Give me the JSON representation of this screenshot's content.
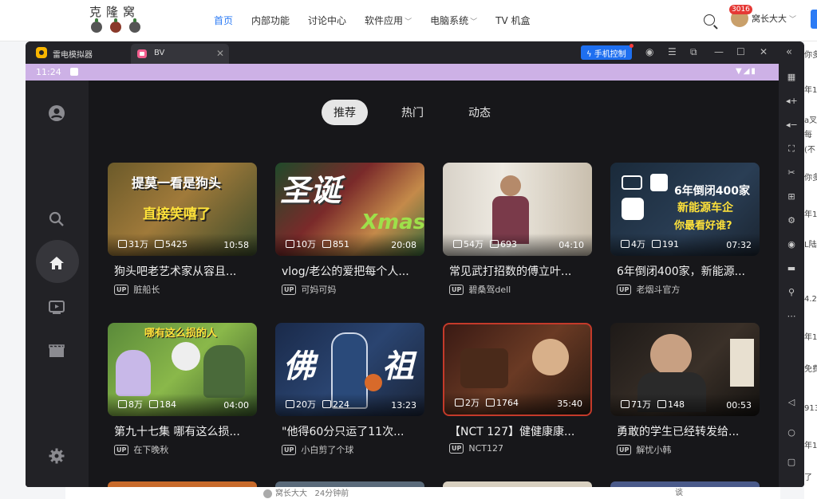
{
  "site": {
    "logo_text": "克隆窝",
    "nav": [
      {
        "label": "首页",
        "active": true,
        "dropdown": false
      },
      {
        "label": "内部功能",
        "active": false,
        "dropdown": false
      },
      {
        "label": "讨论中心",
        "active": false,
        "dropdown": false
      },
      {
        "label": "软件应用",
        "active": false,
        "dropdown": true
      },
      {
        "label": "电脑系统",
        "active": false,
        "dropdown": true
      },
      {
        "label": "TV 机盒",
        "active": false,
        "dropdown": false
      }
    ],
    "user_badge": "3016",
    "user_name": "窝长大大",
    "bottom_user": "窝长大大",
    "bottom_time": "24分钟前",
    "right_fragments": [
      "你多",
      "年1",
      "a叉",
      "每",
      "(不",
      "你多",
      "年1",
      "L陆",
      "4.2",
      "年1",
      "免费",
      "913",
      "年1",
      "了"
    ],
    "bottom_right_text": "谈"
  },
  "emulator": {
    "title": "雷电模拟器",
    "tab_label": "BV",
    "phone_control_label": "手机控制",
    "status_time": "11:24",
    "app": {
      "tabs": [
        {
          "label": "推荐",
          "active": true
        },
        {
          "label": "热门",
          "active": false
        },
        {
          "label": "动态",
          "active": false
        }
      ],
      "up_badge": "UP",
      "videos": [
        {
          "title": "狗头吧老艺术家从容且...",
          "uploader": "脏船长",
          "views": "31万",
          "danmaku": "5425",
          "duration": "10:58",
          "caption": "提莫一看是狗头 / 直接笑嘻了"
        },
        {
          "title": "vlog/老公的爱把每个人...",
          "uploader": "可妈可妈",
          "views": "10万",
          "danmaku": "851",
          "duration": "20:08",
          "caption": "圣诞 Xmas"
        },
        {
          "title": "常见武打招数的傅立叶...",
          "uploader": "碧桑驾dell",
          "views": "54万",
          "danmaku": "693",
          "duration": "04:10",
          "caption": ""
        },
        {
          "title": "6年倒闭400家，新能源...",
          "uploader": "老烟斗官方",
          "views": "4万",
          "danmaku": "191",
          "duration": "07:32",
          "caption": "6年倒闭400家 / 新能源车企 / 你最看好谁?"
        },
        {
          "title": "第九十七集 哪有这么损...",
          "uploader": "在下晚秋",
          "views": "8万",
          "danmaku": "184",
          "duration": "04:00",
          "caption": "哪有这么损的人"
        },
        {
          "title": "\"他得60分只运了11次...",
          "uploader": "小白剪了个球",
          "views": "20万",
          "danmaku": "224",
          "duration": "13:23",
          "caption": "佛 祖"
        },
        {
          "title": "【NCT 127】健健康康...",
          "uploader": "NCT127",
          "views": "2万",
          "danmaku": "1764",
          "duration": "35:40",
          "caption": ""
        },
        {
          "title": "勇敢的学生已经转发给...",
          "uploader": "解忧小韩",
          "views": "71万",
          "danmaku": "148",
          "duration": "00:53",
          "caption": ""
        }
      ]
    }
  },
  "colors": {
    "accent_blue": "#2d7cf5",
    "status_bar": "#cdb1e6",
    "emu_bg": "#1b1b1f"
  }
}
